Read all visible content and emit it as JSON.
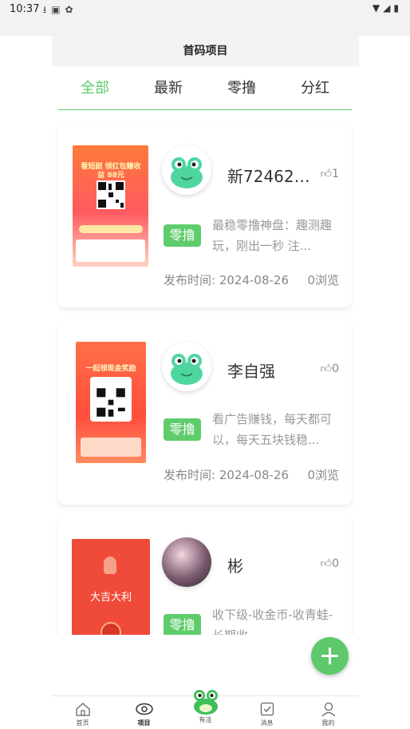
{
  "status_bar": {
    "time": "10:37",
    "left_icons": [
      "download-icon",
      "photo-icon",
      "bug-icon"
    ],
    "right_icons": [
      "wifi-icon",
      "signal-icon",
      "battery-icon"
    ]
  },
  "page_title": "首码项目",
  "tabs": [
    {
      "label": "全部",
      "active": true
    },
    {
      "label": "最新",
      "active": false
    },
    {
      "label": "零撸",
      "active": false
    },
    {
      "label": "分红",
      "active": false
    }
  ],
  "posts": [
    {
      "name": "新724628...",
      "likes": "1",
      "tag": "零撸",
      "description": "最稳零撸神盘：趣测趣玩，刚出一秒 注...",
      "publish_label": "发布时间:",
      "publish_date": "2024-08-26",
      "views": "0浏览",
      "thumb_text": "看短剧 领红包赚收益",
      "thumb_amount": "88元"
    },
    {
      "name": "李自强",
      "likes": "0",
      "tag": "零撸",
      "description": "看广告赚钱，每天都可以，每天五块钱稳...",
      "publish_label": "发布时间:",
      "publish_date": "2024-08-26",
      "views": "0浏览",
      "thumb_text": "一起领现金奖励"
    },
    {
      "name": "彬",
      "likes": "0",
      "tag": "零撸",
      "description": "收下级-收金币-收青蛙-长期收",
      "thumb_text": "大吉大利"
    }
  ],
  "bottom_nav": [
    {
      "label": "首页",
      "icon": "home-icon",
      "active": false
    },
    {
      "label": "项目",
      "icon": "eye-icon",
      "active": true
    },
    {
      "label": "有洼",
      "icon": "frog-icon",
      "active": false
    },
    {
      "label": "消息",
      "icon": "checkbox-icon",
      "active": false
    },
    {
      "label": "我的",
      "icon": "user-icon",
      "active": false
    }
  ],
  "colors": {
    "accent": "#5dc96a",
    "tag_bg": "#5fcc6b",
    "thumb_red": "#f04a3a"
  }
}
